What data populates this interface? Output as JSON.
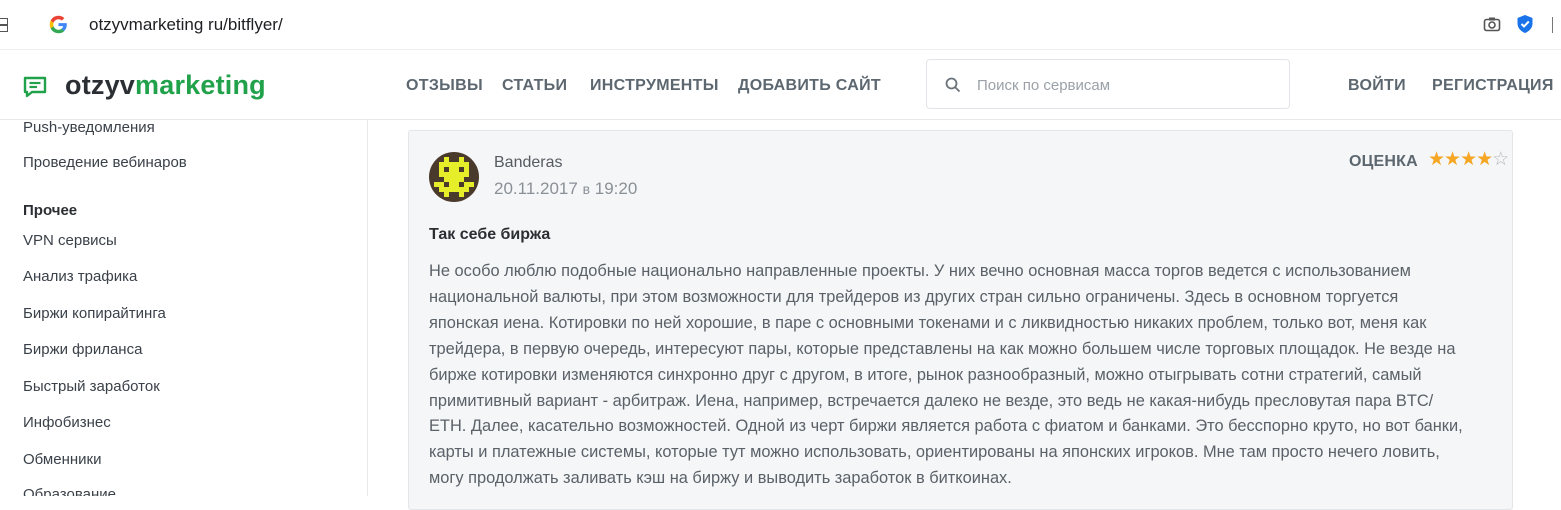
{
  "browser": {
    "url": "otzyvmarketing ru/bitflyer/"
  },
  "header": {
    "logo_part1": "otzyv",
    "logo_part2": "marketing",
    "nav": [
      "ОТЗЫВЫ",
      "СТАТЬИ",
      "ИНСТРУМЕНТЫ",
      "ДОБАВИТЬ САЙТ"
    ],
    "search_placeholder": "Поиск по сервисам",
    "login": "ВОЙТИ",
    "register": "РЕГИСТРАЦИЯ",
    "accent_color": "#21a24a"
  },
  "sidebar": {
    "items_top": [
      "Push-уведомления",
      "Проведение вебинаров"
    ],
    "section_title": "Прочее",
    "items": [
      "VPN сервисы",
      "Анализ трафика",
      "Биржи копирайтинга",
      "Биржи фриланса",
      "Быстрый заработок",
      "Инфобизнес",
      "Обменники",
      "Образование"
    ]
  },
  "review": {
    "author": "Banderas",
    "date": "20.11.2017",
    "date_sep": "в",
    "time": "19:20",
    "rating_label": "ОЦЕНКА",
    "rating": 4,
    "rating_max": 5,
    "title": "Так себе биржа",
    "body_lines": [
      "Не особо люблю подобные национально направленные проекты. У них вечно основная масса торгов ведется с использованием",
      "национальной валюты, при этом возможности для трейдеров из других стран сильно ограничены. Здесь в основном торгуется",
      "японская иена. Котировки по ней хорошие, в паре с основными токенами и с ликвидностью никаких проблем, только вот, меня как",
      "трейдера, в первую очередь, интересуют пары, которые представлены на как можно большем числе торговых площадок. Не везде на",
      "бирже котировки изменяются синхронно друг с другом, в итоге, рынок разнообразный, можно отыгрывать сотни стратегий, самый",
      "примитивный вариант - арбитраж. Иена, например, встречается далеко не везде, это ведь не какая-нибудь пресловутая пара BTC/",
      "ETH. Далее, касательно возможностей. Одной из черт биржи является работа с фиатом и банками. Это бесспорно круто, но вот банки,",
      "карты и платежные системы, которые тут можно использовать, ориентированы на японских игроков. Мне там просто нечего ловить,",
      "могу продолжать заливать кэш на биржу и выводить заработок в биткоинах."
    ]
  }
}
